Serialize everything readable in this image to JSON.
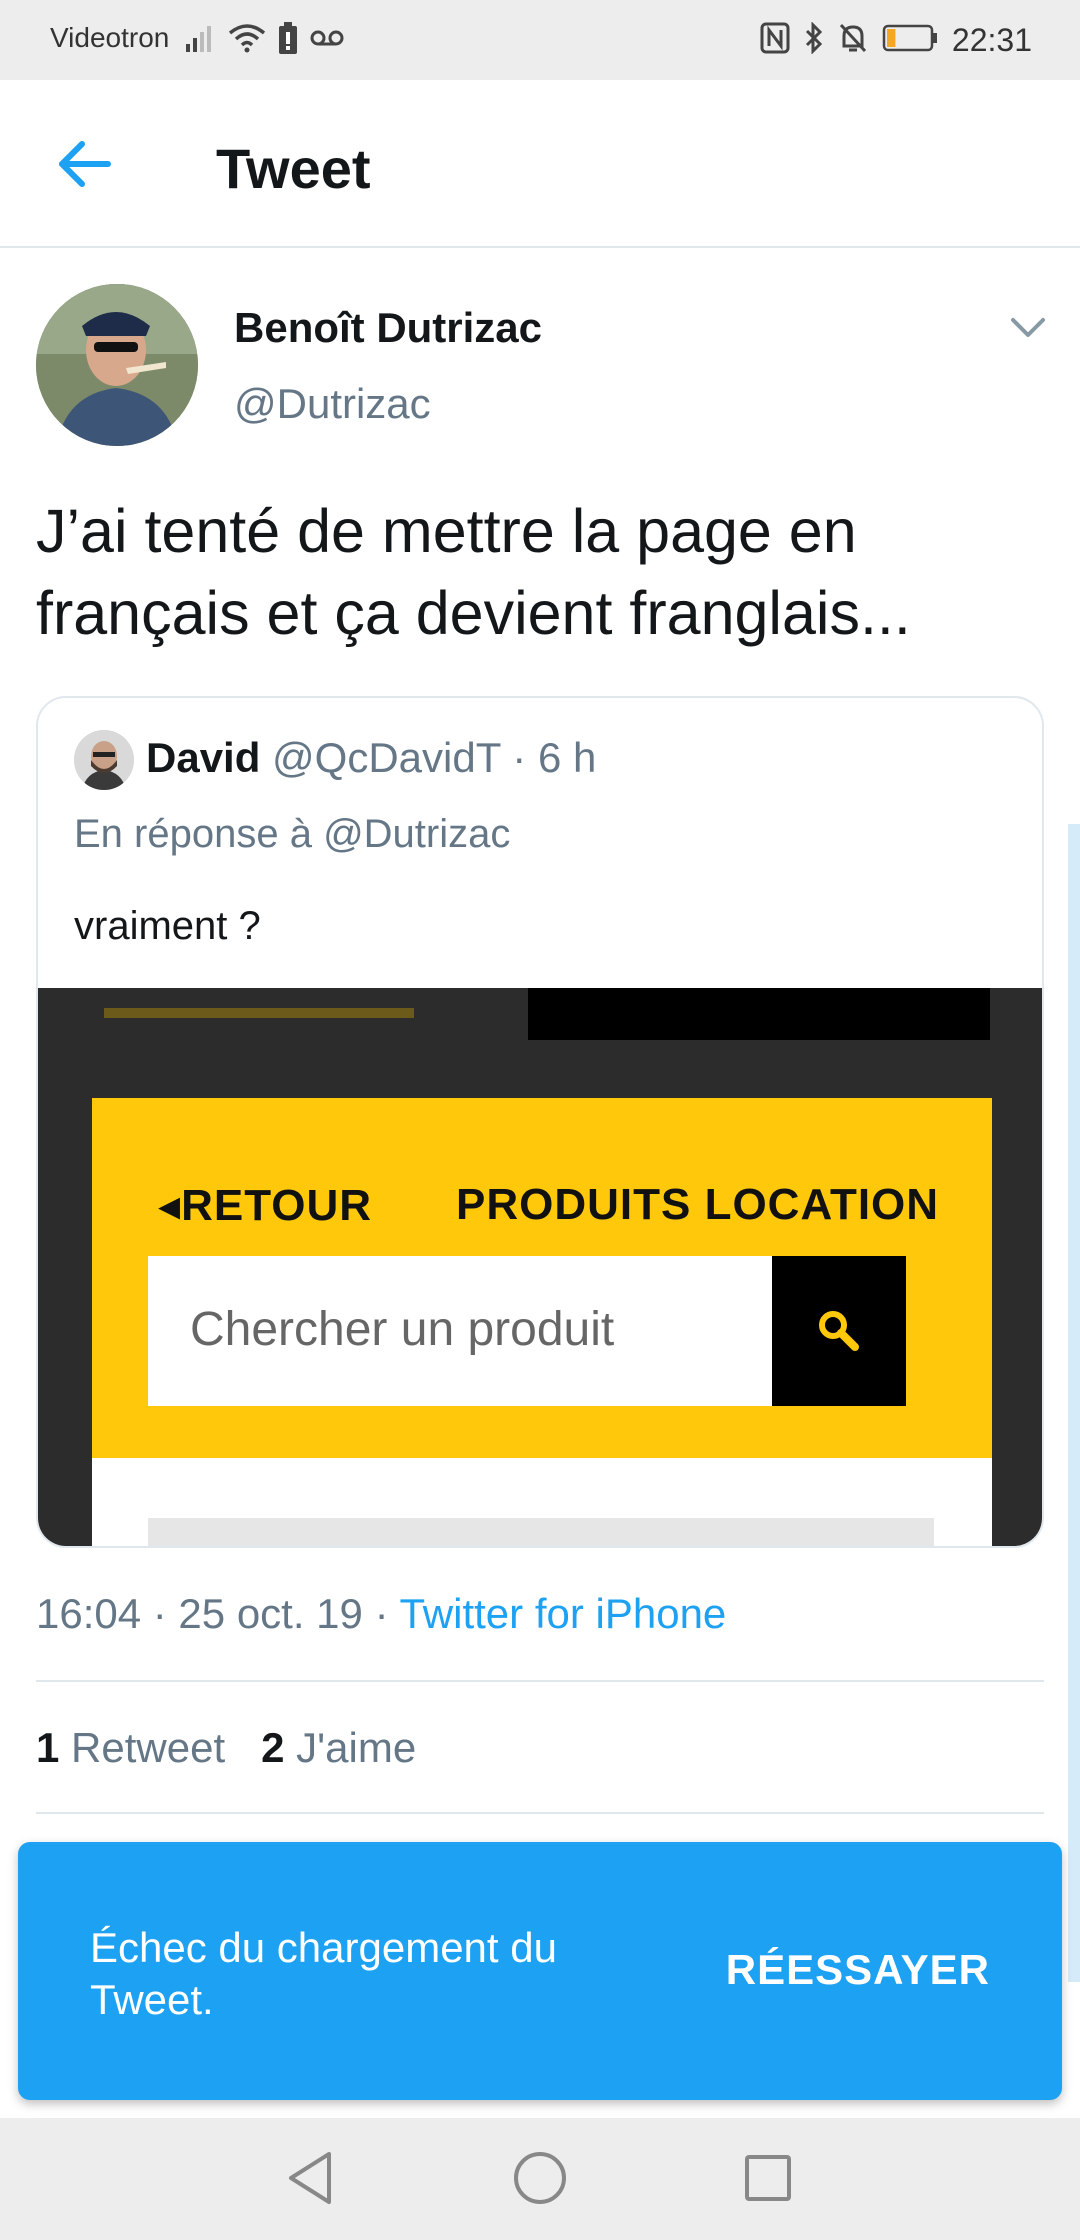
{
  "status_bar": {
    "carrier": "Videotron",
    "time": "22:31",
    "icons": [
      "signal-icon",
      "wifi-icon",
      "battery-saver-icon",
      "voicemail-icon",
      "nfc-icon",
      "bluetooth-icon",
      "do-not-disturb-icon",
      "battery-icon"
    ],
    "battery_level": 0.2
  },
  "header": {
    "title": "Tweet",
    "back_icon": "arrow-left-icon"
  },
  "tweet": {
    "author_name": "Benoît Dutrizac",
    "author_handle": "@Dutrizac",
    "text": "J’ai tenté de mettre la page en français et ça devient franglais...",
    "timestamp": "16:04 · 25 oct. 19 · ",
    "source": "Twitter for iPhone",
    "retweets_count": "1",
    "retweets_label": "Retweet",
    "likes_count": "2",
    "likes_label": "J'aime"
  },
  "quoted_tweet": {
    "author_name": "David",
    "author_handle": "@QcDavidT",
    "time": " · 6 h",
    "reply_to": "En réponse à @Dutrizac",
    "text": "vraiment ?",
    "image": {
      "nav_back": "RETOUR",
      "nav_products": "PRODUITS LOCATION",
      "search_placeholder": "Chercher un produit"
    }
  },
  "snackbar": {
    "message": "Échec du chargement du Tweet.",
    "action": "RÉESSAYER"
  },
  "colors": {
    "accent": "#1da1f2",
    "secondary_text": "#657786",
    "primary_text": "#14171a",
    "brand_yellow": "#ffc80a"
  }
}
